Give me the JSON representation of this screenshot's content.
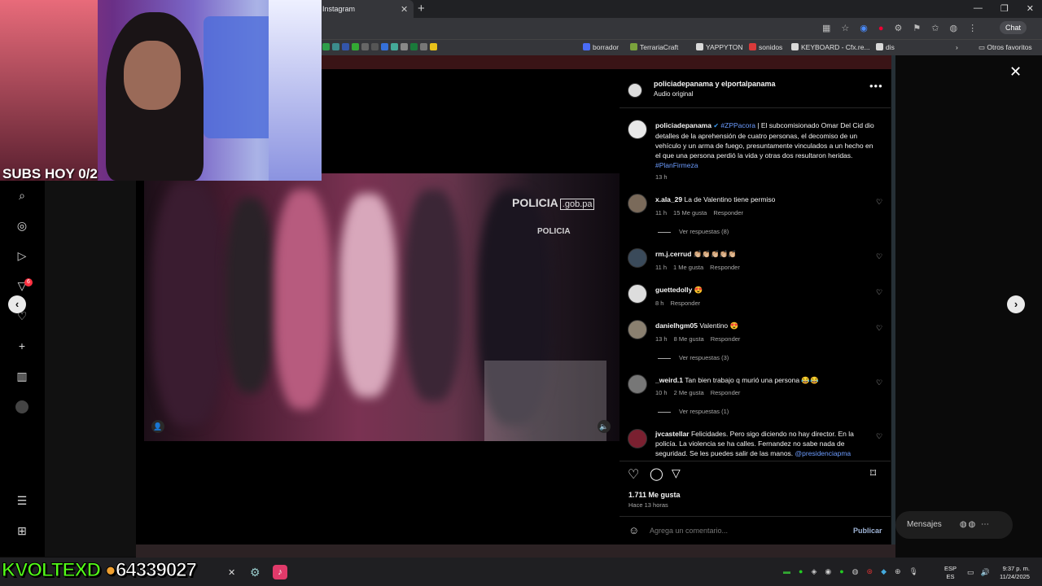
{
  "browser": {
    "tab_title": "Instagram",
    "new_tab_icon": "plus",
    "chat_label": "Chat",
    "bookmarks": [
      {
        "label": "borrador",
        "color": "#4a6cf7"
      },
      {
        "label": "TerrariaCraft",
        "color": "#7aa33c"
      },
      {
        "label": "YAPPYTON",
        "color": "#d9d9d9"
      },
      {
        "label": "sonidos",
        "color": "#d93a3a"
      },
      {
        "label": "KEYBOARD - Cfx.re...",
        "color": "#d9d9d9"
      },
      {
        "label": "dis",
        "color": "#d9d9d9"
      }
    ],
    "other_favorites": "Otros favoritos"
  },
  "stream": {
    "subs_text": "SUBS HOY 0/2",
    "kick_name": "KVOLTEXD",
    "coins": "64339027"
  },
  "video": {
    "watermark": "POLICIA",
    "watermark_domain": ".gob.pa",
    "vest_text": "POLICIA"
  },
  "post": {
    "header_names": "policiadepanama y elportalpanama",
    "header_audio": "Audio original",
    "caption_user": "policiadepanama",
    "caption_hashtag": "#ZPPacora",
    "caption_text": " | El subcomisionado Omar Del Cid dio detalles de la aprehensión de cuatro personas, el decomiso de un vehículo y un arma de fuego, presuntamente vinculados a un hecho en el que una persona perdió la vida y otras dos resultaron heridas. ",
    "caption_hashtag2": "#PlanFirmeza",
    "caption_time": "13 h",
    "likes": "1.711 Me gusta",
    "posted": "Hace 13 horas",
    "comment_placeholder": "Agrega un comentario...",
    "publish": "Publicar",
    "messages": "Mensajes"
  },
  "comments": [
    {
      "user": "x.ala_29",
      "text": "La de Valentino tiene permiso",
      "time": "11 h",
      "likes": "15 Me gusta",
      "reply": "Responder",
      "replies": "Ver respuestas (8)"
    },
    {
      "user": "rm.j.cerrud",
      "text": "👏🏼👏🏼👏🏼👏🏼👏🏼",
      "time": "11 h",
      "likes": "1 Me gusta",
      "reply": "Responder"
    },
    {
      "user": "guettedolly",
      "text": "😍",
      "time": "8 h",
      "reply": "Responder"
    },
    {
      "user": "danielhgm05",
      "text": "Valentino 😍",
      "time": "13 h",
      "likes": "8 Me gusta",
      "reply": "Responder",
      "replies": "Ver respuestas (3)"
    },
    {
      "user": "_weird.1",
      "text": "Tan bien trabajo q murió una persona 😂😂",
      "time": "10 h",
      "likes": "2 Me gusta",
      "reply": "Responder",
      "replies": "Ver respuestas (1)"
    },
    {
      "user": "jvcastellar",
      "text": "Felicidades. Pero sigo diciendo no hay director. En la policía. La violencia se ha calles. Fernandez no sabe nada de seguridad. Se les puedes salir de las manos. ",
      "mention": "@presidenciapma"
    }
  ],
  "taskbar": {
    "lang_top": "ESP",
    "lang_bottom": "ES",
    "time": "9:37 p. m.",
    "date": "11/24/2025"
  },
  "notification_badge": "6"
}
